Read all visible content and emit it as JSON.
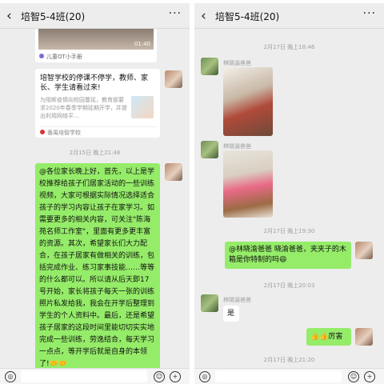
{
  "left": {
    "title": "培智5-4班(20)",
    "back_icon": "‹",
    "more_icon": "···",
    "video_time": "01:40",
    "video_source": "儿童OT小手册",
    "article": {
      "title": "培智学校的停课不停学，教师、家长、学生请看过来!",
      "desc": "为阻断疫情向校园蔓延，教育部要求2020年春季学期延期开学，并提出利用网络平...",
      "source": "番禺培智学校"
    },
    "timestamp": "2月15日 晚上21:48",
    "message": "@各位家长晚上好，首先，以上是学校推荐给孩子们居家活动的一些训练视频，大家可根据实际情况选择适合孩子的学习内容让孩子在家学习。如需要更多的相关内容，可关注\"陈海苑名师工作室\"，里面有更多更丰富的资源。其次，希望家长们大力配合，在孩子居家有做相关的训练，包括完成作业、练习家事技能……等等的什么都可以。所以请从后天即17号开始，家长将孩子每天一张的训练照片私发给我，我会在开学后整理到学生的个人资料中。最后，还是希望孩子居家的这段时间里能切切实实地完成一些训练，劳逸结合，每天学习一点点，等开学后就是自身的本领了!🤝🤝"
  },
  "right": {
    "title": "培智5-4班(20)",
    "back_icon": "‹",
    "more_icon": "···",
    "ts1": "2月17日 晚上18:46",
    "nick1": "林晓渝爸爸",
    "nick2": "林晓渝爸爸",
    "ts2": "2月17日 晚上19:30",
    "msg_me1": "@林晓渝爸爸 晓渝爸爸，夹夹子的木箱是你特制的吗😄",
    "ts3": "2月17日 晚上20:03",
    "nick3": "林晓渝爸爸",
    "msg_other": "是",
    "msg_me2": "👍👍厉害",
    "ts4": "2月17日 晚上21:20"
  },
  "inputbar": {
    "voice_icon": "voice-icon",
    "emoji_icon": "emoji-icon",
    "plus_icon": "plus-icon"
  },
  "colors": {
    "chat_bg": "#ededed",
    "my_bubble": "#95ec69",
    "other_bubble": "#ffffff"
  }
}
